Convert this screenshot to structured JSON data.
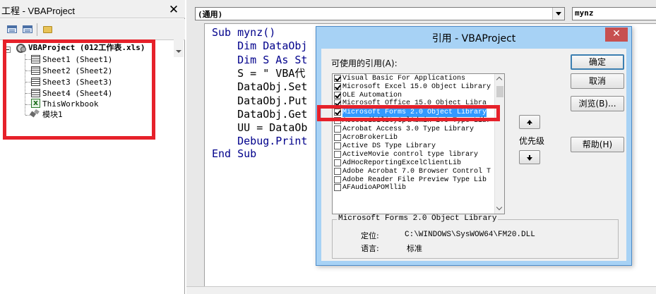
{
  "project_panel": {
    "title": "工程 - VBAProject",
    "close_glyph": "✕",
    "tree": {
      "root_label": "VBAProject (012工作表.xls)",
      "children": [
        {
          "label": "Sheet1 (Sheet1)",
          "icon": "sheet-icon"
        },
        {
          "label": "Sheet2 (Sheet2)",
          "icon": "sheet-icon"
        },
        {
          "label": "Sheet3 (Sheet3)",
          "icon": "sheet-icon"
        },
        {
          "label": "Sheet4 (Sheet4)",
          "icon": "sheet-icon"
        },
        {
          "label": "ThisWorkbook",
          "icon": "workbook-icon"
        },
        {
          "label": "模块1",
          "icon": "module-icon"
        }
      ]
    }
  },
  "code_window": {
    "object_combo": "(通用)",
    "procedure_combo": "mynz",
    "lines": [
      "Sub mynz()",
      "    Dim DataObj",
      "    Dim S As St",
      "    S = \" VBA代",
      "    DataObj.Set",
      "    DataObj.Put",
      "    DataObj.Get",
      "    UU = DataOb",
      "    Debug.Print",
      "End Sub"
    ]
  },
  "dialog": {
    "title": "引用 - VBAProject",
    "close_glyph": "✕",
    "available_label": "可使用的引用(A):",
    "references": [
      {
        "label": "Visual Basic For Applications",
        "checked": true
      },
      {
        "label": "Microsoft Excel 15.0 Object Library",
        "checked": true
      },
      {
        "label": "OLE Automation",
        "checked": true
      },
      {
        "label": "Microsoft Office 15.0 Object Libra",
        "checked": true
      },
      {
        "label": "Microsoft Forms 2.0 Object Library",
        "checked": true,
        "selected": true
      },
      {
        "label": "AccessibilityCplAdmin 1.0 Type Libr",
        "checked": false
      },
      {
        "label": "Acrobat Access 3.0 Type Library",
        "checked": false
      },
      {
        "label": "AcroBrokerLib",
        "checked": false
      },
      {
        "label": "Active DS Type Library",
        "checked": false
      },
      {
        "label": "ActiveMovie control type library",
        "checked": false
      },
      {
        "label": "AdHocReportingExcelClientLib",
        "checked": false
      },
      {
        "label": "Adobe Acrobat 7.0 Browser Control T",
        "checked": false
      },
      {
        "label": "Adobe Reader File Preview Type Lib",
        "checked": false
      },
      {
        "label": "AFAudioAPOMllib",
        "checked": false
      }
    ],
    "buttons": {
      "ok": "确定",
      "cancel": "取消",
      "browse": "浏览(B)...",
      "help": "帮助(H)"
    },
    "priority_label": "优先级",
    "info": {
      "title": "Microsoft Forms 2.0 Object Library",
      "location_label": "定位:",
      "location_value": "C:\\WINDOWS\\SysWOW64\\FM20.DLL",
      "language_label": "语言:",
      "language_value": "标准"
    }
  },
  "colors": {
    "highlight_red": "#e6212a",
    "dialog_frame": "#a7d2f5",
    "selection_blue": "#3399ff",
    "code_keyword": "#00008b"
  }
}
